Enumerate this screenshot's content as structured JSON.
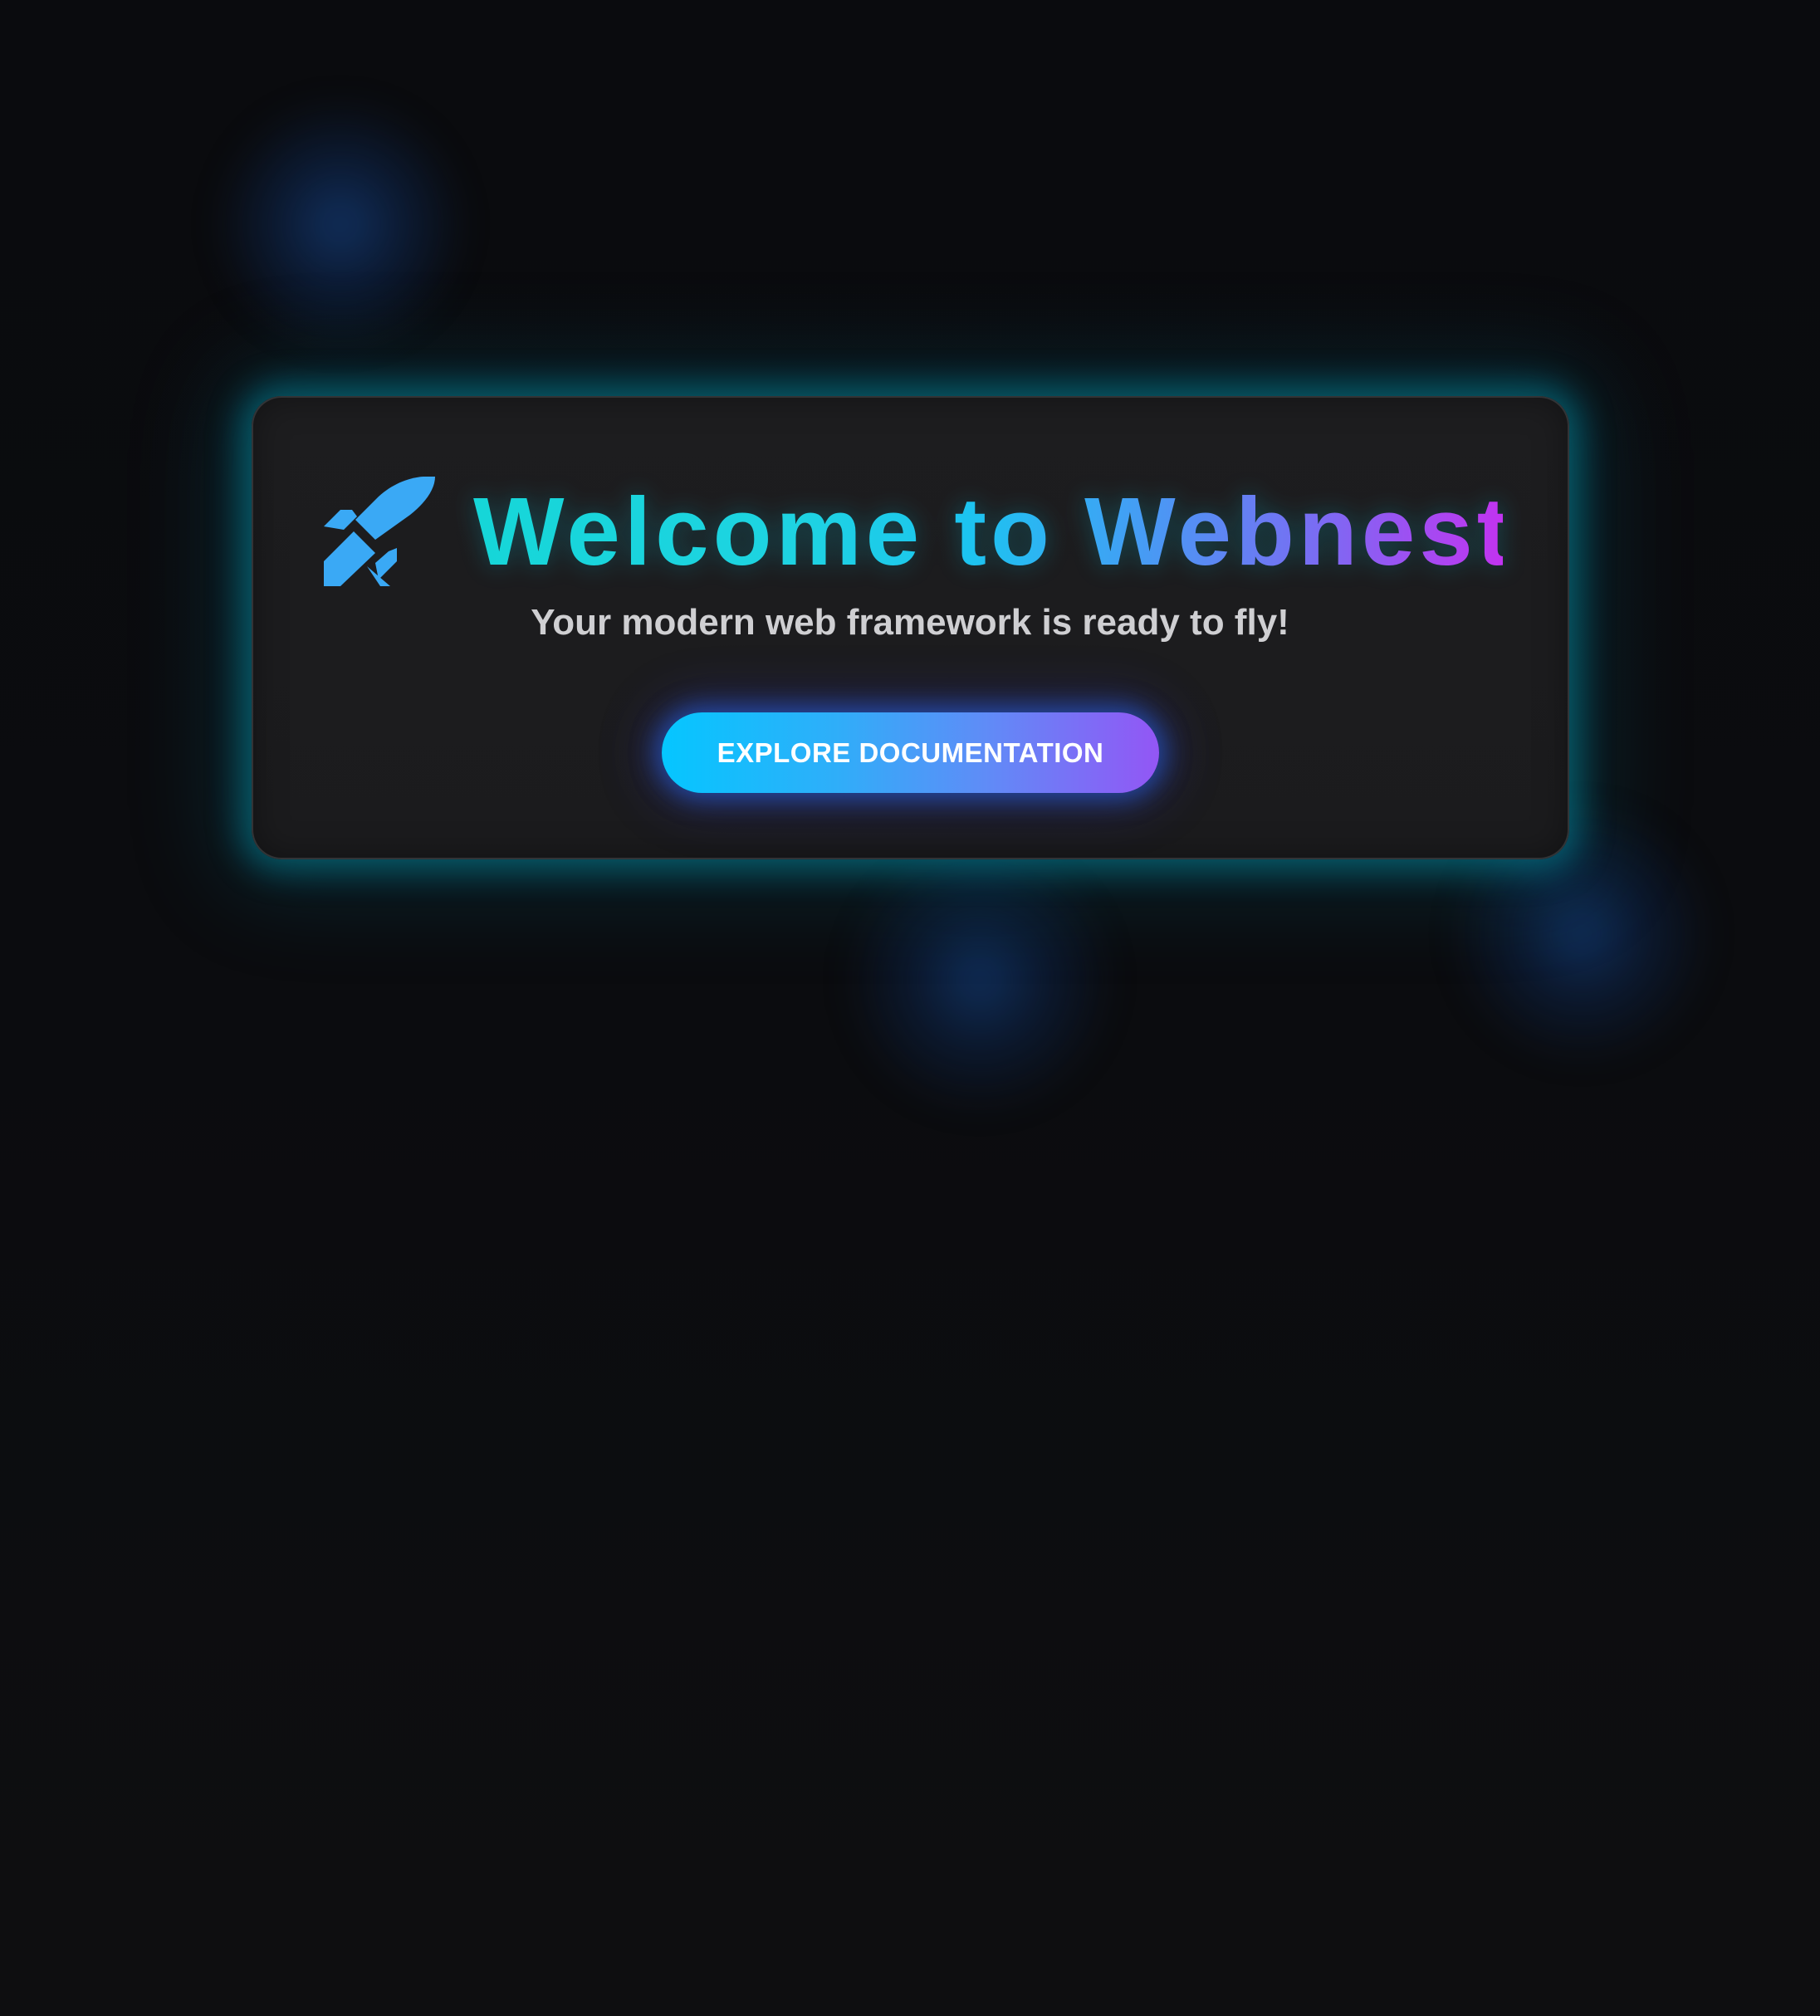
{
  "hero": {
    "icon": "rocket-icon",
    "title": "Welcome to Webnest!",
    "subtitle": "Your modern web framework is ready to fly!",
    "cta_label": "EXPLORE DOCUMENTATION"
  },
  "colors": {
    "background": "#0b0c0f",
    "card": "#1c1c1e",
    "card_glow": "#00afc8",
    "icon": "#3aa9f5",
    "title_gradient_start": "#16d6d8",
    "title_gradient_mid": "#1cc4f0",
    "title_gradient_end": "#c233f0",
    "subtitle_text": "#cfcfd2",
    "button_gradient_start": "#05c6ff",
    "button_gradient_end": "#9356f5",
    "button_text": "#ffffff"
  }
}
